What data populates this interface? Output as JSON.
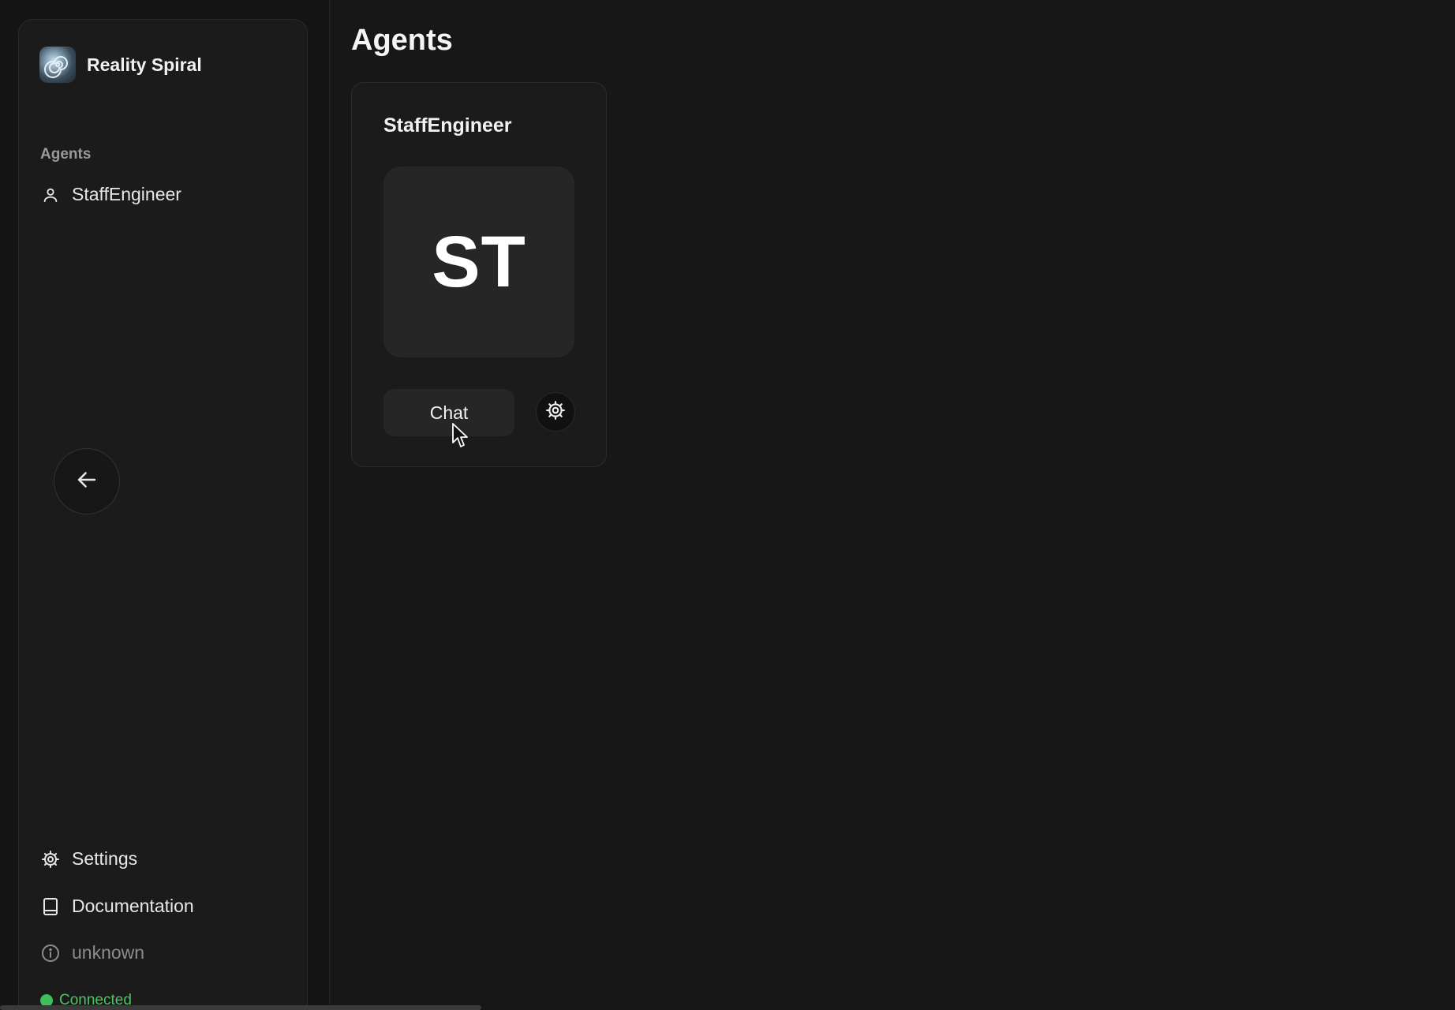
{
  "sidebar": {
    "brand": {
      "name": "Reality Spiral",
      "logo_icon": "spiral-logo-icon"
    },
    "section_label": "Agents",
    "agents": [
      {
        "label": "StaffEngineer",
        "icon": "user-icon"
      }
    ],
    "footer": {
      "settings_label": "Settings",
      "documentation_label": "Documentation",
      "version_label": "unknown",
      "status_label": "Connected"
    }
  },
  "main": {
    "title": "Agents",
    "agent_card": {
      "name": "StaffEngineer",
      "initials": "ST",
      "chat_label": "Chat",
      "settings_icon": "gear-icon"
    }
  },
  "colors": {
    "background": "#171717",
    "sidebar": "#1b1b1b",
    "status_green": "#3fbf5a"
  }
}
